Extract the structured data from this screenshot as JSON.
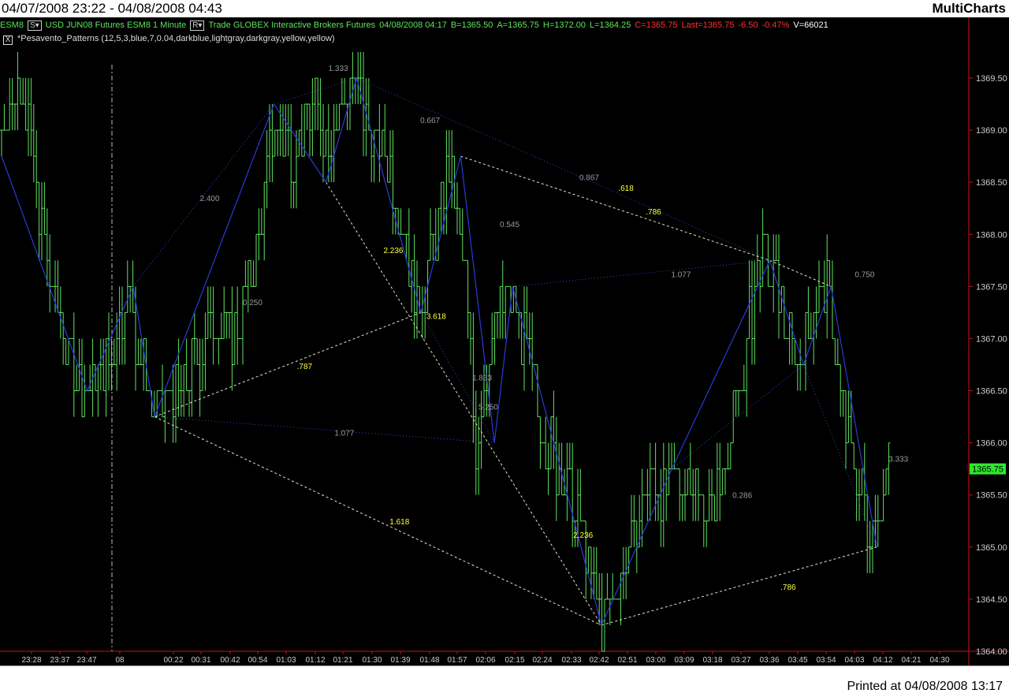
{
  "title": {
    "range": "04/07/2008 23:22 - 04/08/2008 04:43",
    "app": "MultiCharts"
  },
  "status": {
    "symbol": "ESM8",
    "s_tag": "S▾",
    "instrument": "USD JUN08 Futures ESM8 1 Minute",
    "r_tag": "R▾",
    "feed": "Trade GLOBEX Interactive Brokers Futures",
    "datetime": "04/08/2008 04:17",
    "bid": "B=1365.50",
    "ask": "A=1365.75",
    "high": "H=1372.00",
    "low": "L=1364.25",
    "close": "C=1365.75",
    "last": "Last=1365.75",
    "change": "-6.50",
    "change_pct": "-0.47%",
    "volume": "V=66021"
  },
  "indicator": {
    "checkbox": "X",
    "label": "*Pesavento_Patterns (12,5,3,blue,7,0.04,darkblue,lightgray,darkgray,yellow,yellow)"
  },
  "footer": {
    "printed": "Printed at 04/08/2008 13:17"
  },
  "colors": {
    "bars": "#5fe35f",
    "zigzag": "#2a3ad8",
    "ratio_gray": "#9a9a9a",
    "ratio_yellow": "#ffff40",
    "last_price_bg": "#2ee82e",
    "red_text": "#ff3030",
    "axis_red": "#d01010"
  },
  "chart_data": {
    "type": "bar",
    "subtype": "ohlc-1minute-with-pesavento-patterns",
    "y_axis": {
      "ticks": [
        "1369.50",
        "1369.00",
        "1368.50",
        "1368.00",
        "1367.50",
        "1367.00",
        "1366.50",
        "1366.00",
        "1365.50",
        "1365.00",
        "1364.50",
        "1364.00"
      ],
      "range": [
        1364.0,
        1369.75
      ]
    },
    "x_axis": {
      "tick_labels": [
        "23:28",
        "23:37",
        "23:47",
        "08",
        "00:22",
        "00:31",
        "00:42",
        "00:54",
        "01:03",
        "01:12",
        "01:21",
        "01:30",
        "01:39",
        "01:48",
        "01:57",
        "02:06",
        "02:15",
        "02:24",
        "02:33",
        "02:42",
        "02:51",
        "03:00",
        "03:09",
        "03:18",
        "03:27",
        "03:36",
        "03:45",
        "03:54",
        "04:03",
        "04:12",
        "04:21",
        "04:30"
      ]
    },
    "last_price": "1365.75",
    "price_path": [
      {
        "x": 0.0,
        "price": 1369.0
      },
      {
        "x": 0.7,
        "price": 1369.5
      },
      {
        "x": 1.1,
        "price": 1368.5
      },
      {
        "x": 1.6,
        "price": 1367.5
      },
      {
        "x": 2.3,
        "price": 1366.75
      },
      {
        "x": 2.9,
        "price": 1366.5
      },
      {
        "x": 3.5,
        "price": 1366.75
      },
      {
        "x": 4.1,
        "price": 1367.5
      },
      {
        "x": 4.6,
        "price": 1366.75
      },
      {
        "x": 5.0,
        "price": 1366.25
      },
      {
        "x": 5.7,
        "price": 1366.5
      },
      {
        "x": 6.4,
        "price": 1366.75
      },
      {
        "x": 7.0,
        "price": 1367.25
      },
      {
        "x": 7.6,
        "price": 1367.0
      },
      {
        "x": 8.3,
        "price": 1367.75
      },
      {
        "x": 8.9,
        "price": 1369.0
      },
      {
        "x": 9.5,
        "price": 1368.75
      },
      {
        "x": 10.2,
        "price": 1369.25
      },
      {
        "x": 10.7,
        "price": 1369.0
      },
      {
        "x": 11.5,
        "price": 1369.5
      },
      {
        "x": 12.0,
        "price": 1369.0
      },
      {
        "x": 12.6,
        "price": 1368.75
      },
      {
        "x": 13.2,
        "price": 1368.0
      },
      {
        "x": 13.6,
        "price": 1367.25
      },
      {
        "x": 14.0,
        "price": 1367.75
      },
      {
        "x": 14.6,
        "price": 1368.75
      },
      {
        "x": 15.1,
        "price": 1367.75
      },
      {
        "x": 15.5,
        "price": 1366.0
      },
      {
        "x": 16.0,
        "price": 1367.0
      },
      {
        "x": 16.5,
        "price": 1367.5
      },
      {
        "x": 17.0,
        "price": 1367.0
      },
      {
        "x": 17.6,
        "price": 1366.25
      },
      {
        "x": 18.2,
        "price": 1365.75
      },
      {
        "x": 18.8,
        "price": 1365.25
      },
      {
        "x": 19.3,
        "price": 1364.75
      },
      {
        "x": 19.6,
        "price": 1364.25
      },
      {
        "x": 20.0,
        "price": 1364.5
      },
      {
        "x": 20.6,
        "price": 1365.0
      },
      {
        "x": 21.2,
        "price": 1365.75
      },
      {
        "x": 21.8,
        "price": 1365.5
      },
      {
        "x": 22.5,
        "price": 1365.75
      },
      {
        "x": 23.1,
        "price": 1365.25
      },
      {
        "x": 23.6,
        "price": 1365.75
      },
      {
        "x": 24.1,
        "price": 1366.5
      },
      {
        "x": 24.6,
        "price": 1367.5
      },
      {
        "x": 25.0,
        "price": 1367.75
      },
      {
        "x": 25.5,
        "price": 1367.25
      },
      {
        "x": 26.0,
        "price": 1366.75
      },
      {
        "x": 26.5,
        "price": 1367.25
      },
      {
        "x": 27.0,
        "price": 1367.5
      },
      {
        "x": 27.5,
        "price": 1366.25
      },
      {
        "x": 27.9,
        "price": 1365.75
      },
      {
        "x": 28.3,
        "price": 1365.25
      },
      {
        "x": 28.7,
        "price": 1365.5
      },
      {
        "x": 29.0,
        "price": 1365.75
      }
    ],
    "zigzag": [
      {
        "x": 0.0,
        "price": 1368.75
      },
      {
        "x": 2.8,
        "price": 1366.5
      },
      {
        "x": 4.3,
        "price": 1367.5
      },
      {
        "x": 5.0,
        "price": 1366.25
      },
      {
        "x": 8.9,
        "price": 1369.25
      },
      {
        "x": 10.6,
        "price": 1368.5
      },
      {
        "x": 11.6,
        "price": 1369.5
      },
      {
        "x": 13.7,
        "price": 1367.25
      },
      {
        "x": 15.0,
        "price": 1368.75
      },
      {
        "x": 16.1,
        "price": 1366.0
      },
      {
        "x": 16.7,
        "price": 1367.5
      },
      {
        "x": 19.6,
        "price": 1364.25
      },
      {
        "x": 21.9,
        "price": 1365.75
      },
      {
        "x": 25.1,
        "price": 1367.75
      },
      {
        "x": 26.2,
        "price": 1366.75
      },
      {
        "x": 27.1,
        "price": 1367.5
      },
      {
        "x": 28.6,
        "price": 1365.0
      }
    ],
    "pattern_lines": [
      {
        "from": {
          "x": 5.0,
          "price": 1366.25
        },
        "to": {
          "x": 13.7,
          "price": 1367.25
        },
        "style": "yellow"
      },
      {
        "from": {
          "x": 5.0,
          "price": 1366.25
        },
        "to": {
          "x": 19.6,
          "price": 1364.25
        },
        "style": "yellow"
      },
      {
        "from": {
          "x": 10.6,
          "price": 1368.5
        },
        "to": {
          "x": 19.6,
          "price": 1364.25
        },
        "style": "yellow"
      },
      {
        "from": {
          "x": 15.0,
          "price": 1368.75
        },
        "to": {
          "x": 25.1,
          "price": 1367.75
        },
        "style": "yellow"
      },
      {
        "from": {
          "x": 19.6,
          "price": 1364.25
        },
        "to": {
          "x": 28.6,
          "price": 1365.0
        },
        "style": "yellow"
      },
      {
        "from": {
          "x": 25.1,
          "price": 1367.75
        },
        "to": {
          "x": 27.1,
          "price": 1367.5
        },
        "style": "yellow"
      },
      {
        "from": {
          "x": 11.6,
          "price": 1369.5
        },
        "to": {
          "x": 25.1,
          "price": 1367.75
        },
        "style": "gray"
      },
      {
        "from": {
          "x": 8.9,
          "price": 1369.25
        },
        "to": {
          "x": 11.6,
          "price": 1369.5
        },
        "style": "gray"
      },
      {
        "from": {
          "x": 5.0,
          "price": 1366.25
        },
        "to": {
          "x": 16.1,
          "price": 1366.0
        },
        "style": "gray"
      },
      {
        "from": {
          "x": 16.7,
          "price": 1367.5
        },
        "to": {
          "x": 25.1,
          "price": 1367.75
        },
        "style": "gray"
      },
      {
        "from": {
          "x": 4.3,
          "price": 1367.5
        },
        "to": {
          "x": 8.9,
          "price": 1369.25
        },
        "style": "gray"
      },
      {
        "from": {
          "x": 13.7,
          "price": 1367.25
        },
        "to": {
          "x": 16.1,
          "price": 1366.0
        },
        "style": "gray"
      },
      {
        "from": {
          "x": 21.9,
          "price": 1365.75
        },
        "to": {
          "x": 26.2,
          "price": 1366.75
        },
        "style": "gray"
      },
      {
        "from": {
          "x": 26.2,
          "price": 1366.75
        },
        "to": {
          "x": 28.6,
          "price": 1365.0
        },
        "style": "gray"
      }
    ],
    "ratio_labels": [
      {
        "text": "1.333",
        "x": 11.0,
        "price": 1369.6,
        "color": "gray"
      },
      {
        "text": "0.667",
        "x": 14.0,
        "price": 1369.1,
        "color": "gray"
      },
      {
        "text": "2.400",
        "x": 6.8,
        "price": 1368.35,
        "color": "gray"
      },
      {
        "text": "0.867",
        "x": 19.2,
        "price": 1368.55,
        "color": "gray"
      },
      {
        "text": ".618",
        "x": 20.4,
        "price": 1368.45,
        "color": "yellow"
      },
      {
        "text": ".786",
        "x": 21.3,
        "price": 1368.22,
        "color": "yellow"
      },
      {
        "text": "0.545",
        "x": 16.6,
        "price": 1368.1,
        "color": "gray"
      },
      {
        "text": "2.236",
        "x": 12.8,
        "price": 1367.85,
        "color": "yellow"
      },
      {
        "text": "1.077",
        "x": 22.2,
        "price": 1367.62,
        "color": "gray"
      },
      {
        "text": "0.750",
        "x": 28.2,
        "price": 1367.62,
        "color": "gray"
      },
      {
        "text": "0.250",
        "x": 8.2,
        "price": 1367.35,
        "color": "gray"
      },
      {
        "text": "3.618",
        "x": 14.2,
        "price": 1367.22,
        "color": "yellow"
      },
      {
        "text": ".787",
        "x": 9.9,
        "price": 1366.74,
        "color": "yellow"
      },
      {
        "text": "1.833",
        "x": 15.7,
        "price": 1366.63,
        "color": "gray"
      },
      {
        "text": "5.250",
        "x": 15.9,
        "price": 1366.35,
        "color": "gray"
      },
      {
        "text": "1.077",
        "x": 11.2,
        "price": 1366.1,
        "color": "gray"
      },
      {
        "text": "3.333",
        "x": 29.3,
        "price": 1365.85,
        "color": "gray"
      },
      {
        "text": "0.286",
        "x": 24.2,
        "price": 1365.5,
        "color": "gray"
      },
      {
        "text": "1.618",
        "x": 13.0,
        "price": 1365.25,
        "color": "yellow"
      },
      {
        "text": "2.236",
        "x": 19.0,
        "price": 1365.12,
        "color": "yellow"
      },
      {
        "text": ".786",
        "x": 25.7,
        "price": 1364.62,
        "color": "yellow"
      }
    ]
  }
}
